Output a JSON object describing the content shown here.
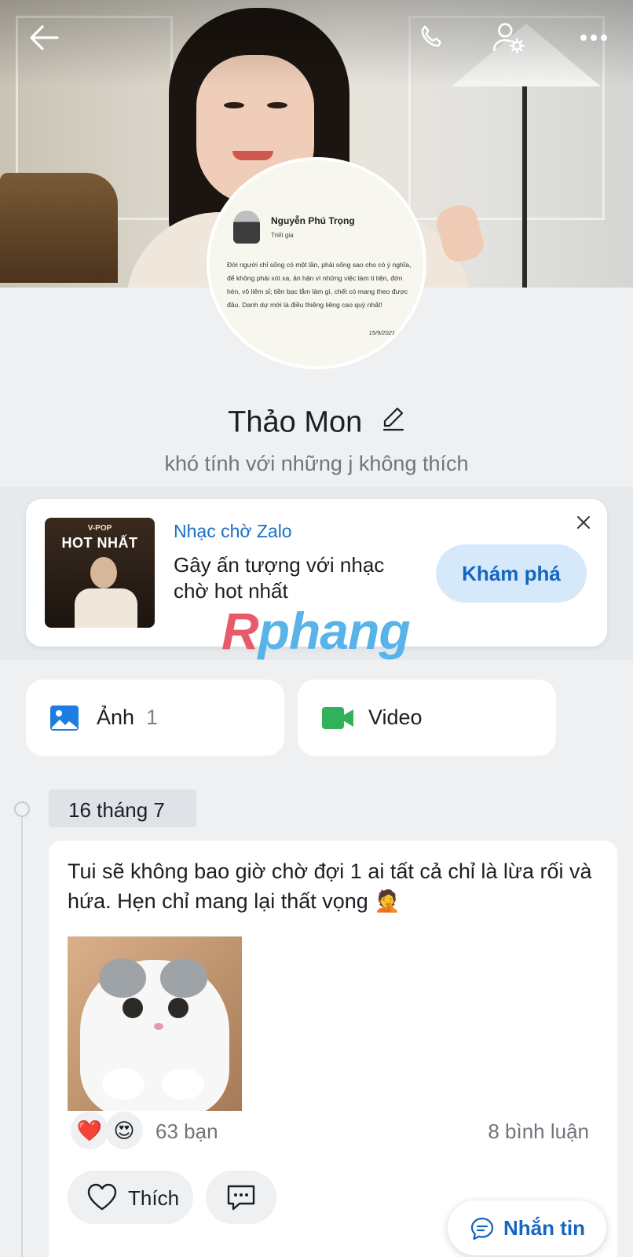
{
  "avatar_quote": {
    "author": "Nguyễn Phú Trọng",
    "role": "Triết gia",
    "text": "Đời người chỉ sống có một lần, phải sống sao cho có ý nghĩa, để không phải xót xa, ân hận vì những việc làm ti tiện, đớn hèn, vô liêm sỉ; tiền bạc lắm làm gì, chết có mang theo được đâu. Danh dự mới là điều thiêng liêng cao quý nhất!",
    "date": "15/9/2021"
  },
  "profile": {
    "name": "Thảo Mon",
    "bio": "khó tính với những j không thích"
  },
  "music_banner": {
    "thumb_tag": "V-POP",
    "thumb_title": "HOT NHẤT",
    "source": "Nhạc chờ Zalo",
    "description": "Gây ấn tượng với nhạc chờ hot nhất",
    "cta_label": "Khám phá"
  },
  "watermark": {
    "first_letter": "R",
    "rest": "phang"
  },
  "media": {
    "photos_label": "Ảnh",
    "photos_count": "1",
    "video_label": "Video"
  },
  "timeline": {
    "date_label": "16 tháng 7"
  },
  "post": {
    "text": "Tui sẽ không bao giờ chờ đợi 1 ai tất cả chỉ là lừa rối và   hứa. Hẹn chỉ mang lại thất vọng 🤦",
    "reactions": [
      "❤️",
      "😍"
    ],
    "reaction_count": "63 bạn",
    "comment_count": "8 bình luận",
    "like_label": "Thích"
  },
  "message_button": {
    "label": "Nhắn tin"
  },
  "colors": {
    "accent": "#1566c0",
    "background": "#eef0f2",
    "video_icon": "#31b25a",
    "photo_icon": "#1e7de0"
  },
  "icons": [
    "back-arrow-icon",
    "phone-icon",
    "user-settings-icon",
    "more-icon",
    "pencil-icon",
    "close-icon",
    "photo-icon",
    "video-icon",
    "heart-icon",
    "comment-icon",
    "chat-icon"
  ]
}
